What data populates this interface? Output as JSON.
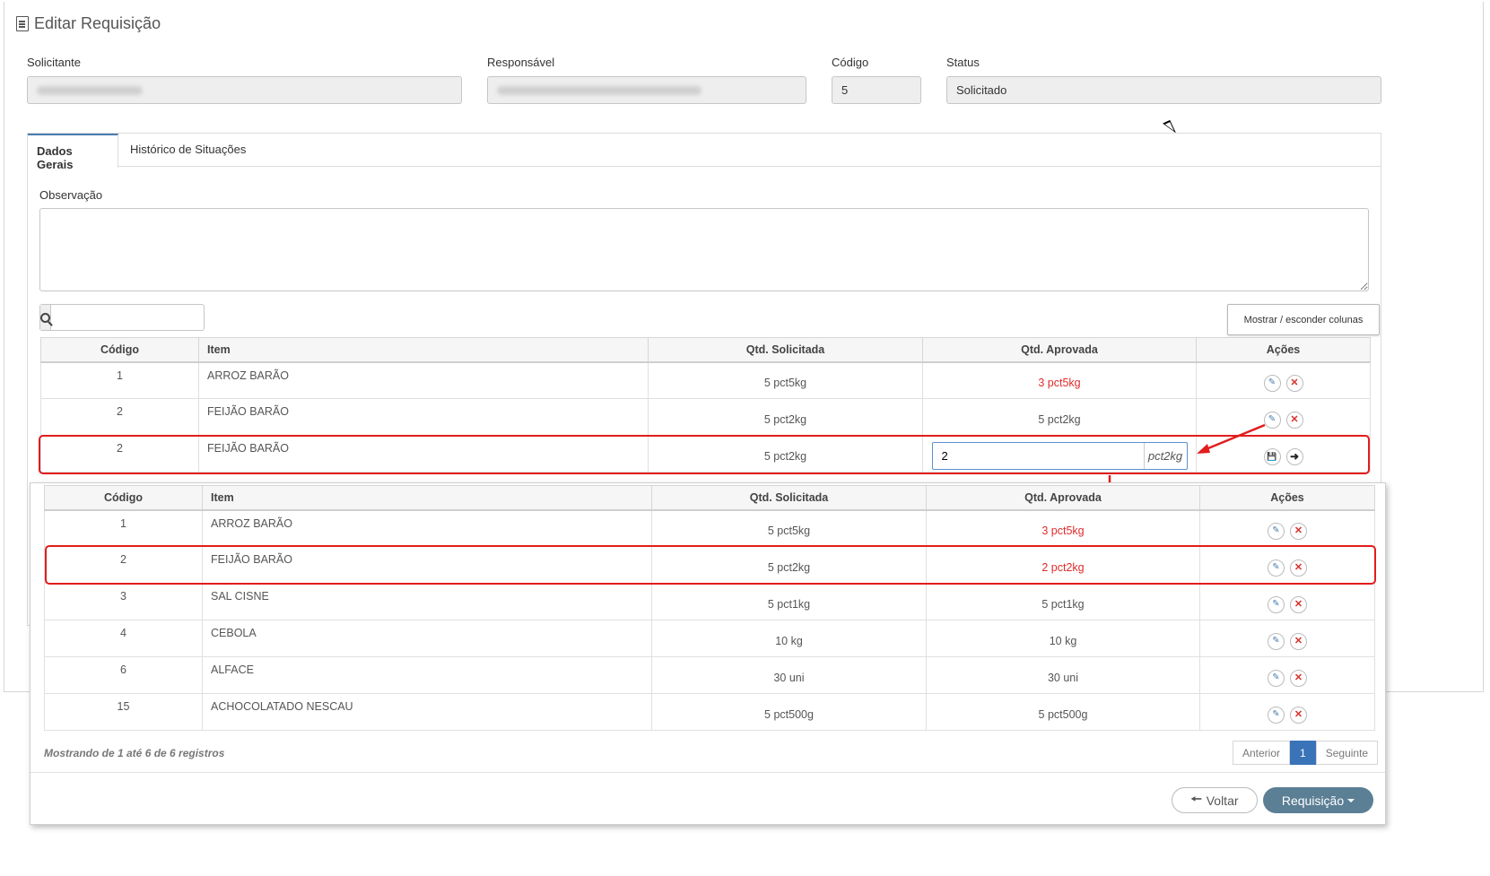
{
  "page": {
    "title": "Editar Requisição"
  },
  "fields": {
    "solicitante": {
      "label": "Solicitante"
    },
    "responsavel": {
      "label": "Responsável"
    },
    "codigo": {
      "label": "Código",
      "value": "5"
    },
    "status": {
      "label": "Status",
      "value": "Solicitado"
    }
  },
  "tabs": [
    {
      "label": "Dados Gerais"
    },
    {
      "label": "Histórico de Situações"
    }
  ],
  "observacao": {
    "label": "Observação",
    "value": ""
  },
  "search": {
    "value": ""
  },
  "toolbar": {
    "cols_label": "Mostrar / esconder colunas"
  },
  "columns": [
    "Código",
    "Item",
    "Qtd. Solicitada",
    "Qtd. Aprovada",
    "Ações"
  ],
  "table1": {
    "rows": [
      {
        "code": "1",
        "item": "ARROZ BARÃO",
        "req": "5 pct5kg",
        "apr": "3 pct5kg"
      },
      {
        "code": "2",
        "item": "FEIJÃO BARÃO",
        "req": "5 pct2kg",
        "apr": "5 pct2kg"
      }
    ],
    "edit_row": {
      "code": "2",
      "item": "FEIJÃO BARÃO",
      "req": "5 pct2kg",
      "input_value": "2",
      "input_unit": "pct2kg"
    }
  },
  "table2": {
    "rows": [
      {
        "code": "1",
        "item": "ARROZ BARÃO",
        "req": "5 pct5kg",
        "apr": "3 pct5kg"
      },
      {
        "code": "2",
        "item": "FEIJÃO BARÃO",
        "req": "5 pct2kg",
        "apr": "2 pct2kg"
      },
      {
        "code": "3",
        "item": "SAL CISNE",
        "req": "5 pct1kg",
        "apr": "5 pct1kg"
      },
      {
        "code": "4",
        "item": "CEBOLA",
        "req": "10 kg",
        "apr": "10 kg"
      },
      {
        "code": "6",
        "item": "ALFACE",
        "req": "30 uni",
        "apr": "30 uni"
      },
      {
        "code": "15",
        "item": "ACHOCOLATADO NESCAU",
        "req": "5 pct500g",
        "apr": "5 pct500g"
      }
    ]
  },
  "pagination": {
    "info": "Mostrando de 1 até 6 de 6 registros",
    "prev": "Anterior",
    "page": "1",
    "next": "Seguinte"
  },
  "buttons": {
    "back": "Voltar",
    "requisicao": "Requisição"
  },
  "colors": {
    "accent": "#3a73b8",
    "highlight": "#e21c1c",
    "approved_changed": "#e02b2b",
    "primary_button": "#5b7f95"
  }
}
